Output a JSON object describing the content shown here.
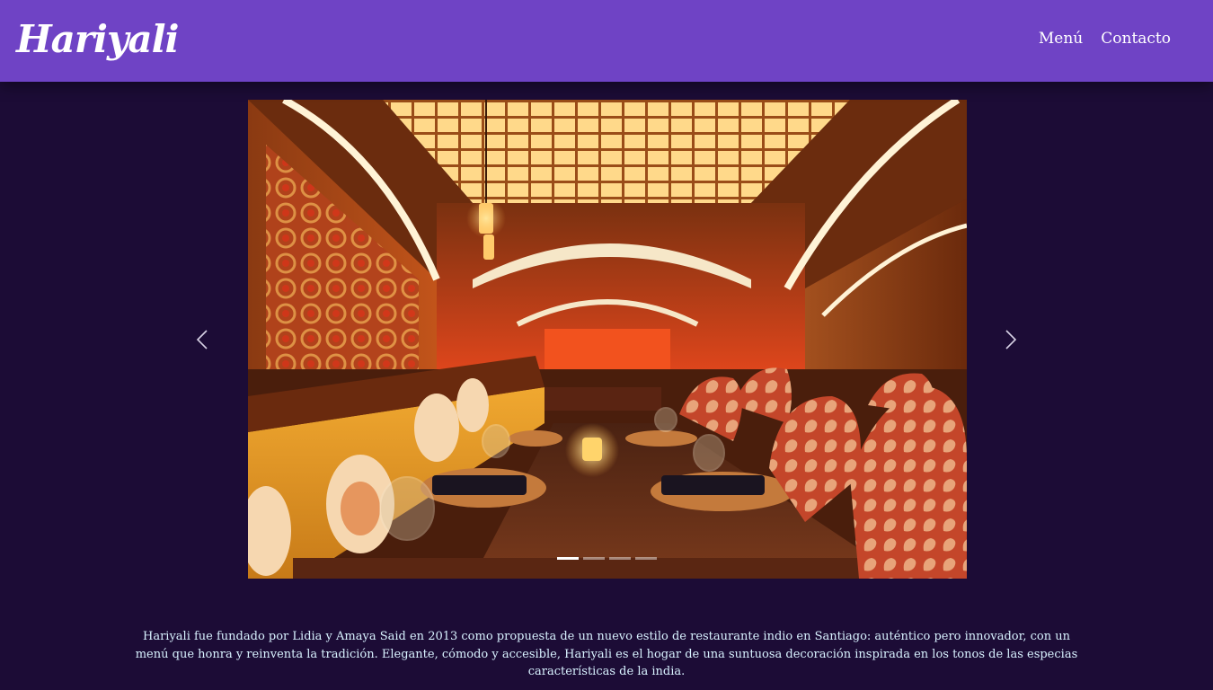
{
  "brand": {
    "name": "Hariyali"
  },
  "nav": {
    "items": [
      "Menú",
      "Contacto"
    ]
  },
  "carousel": {
    "image_alt": "Comedor del restaurante Hariyali",
    "active_slide": 1,
    "slide_count": 4
  },
  "about": {
    "text": "Hariyali fue fundado por Lidia y Amaya Said en 2013 como propuesta de un nuevo estilo de restaurante indio en Santiago: auténtico pero innovador, con un menú que honra y reinventa la tradición. Elegante, cómodo y accesible, Hariyali es el hogar de una suntuosa decoración inspirada en los tonos de las especias características de la india."
  },
  "colors": {
    "navbar": "#6f43c5",
    "background": "#1c0c36",
    "description_text": "#d8f2ff"
  }
}
